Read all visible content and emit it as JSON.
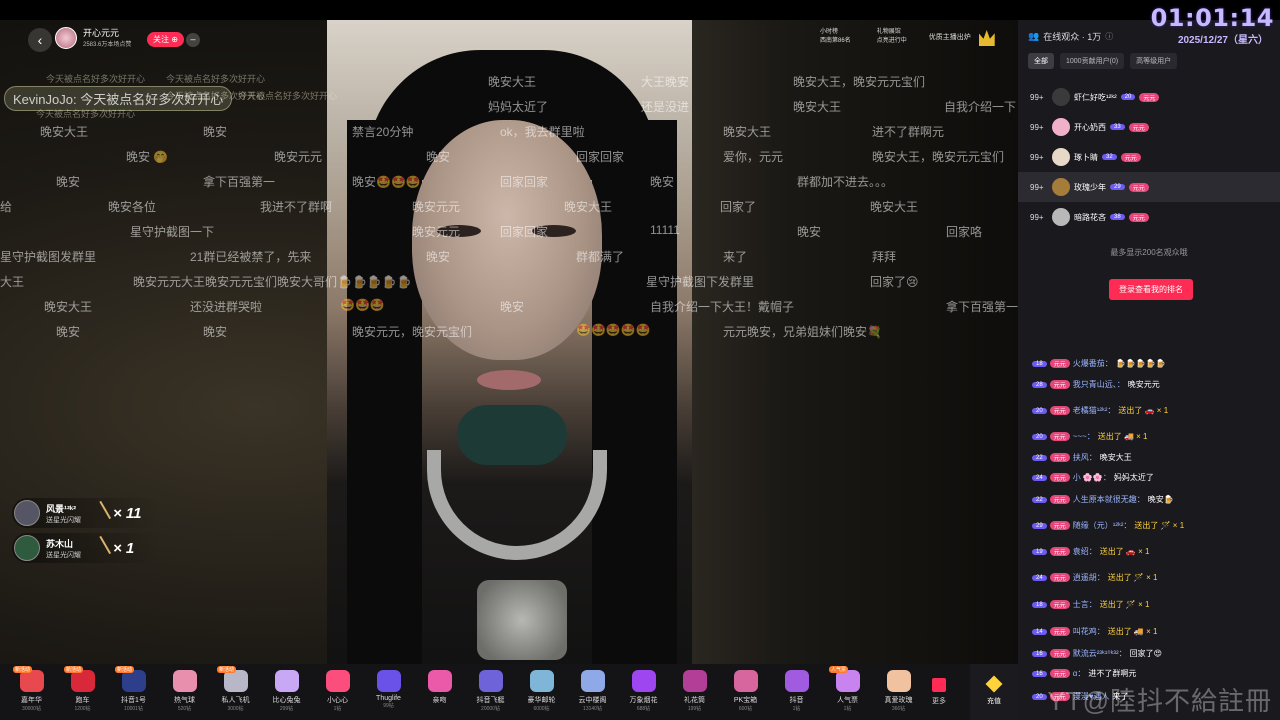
{
  "overlay": {
    "timer": "01:01:14",
    "date": "2025/12/27（星六）",
    "watermark": "YT@陸抖不給註冊"
  },
  "anchor": {
    "name": "开心元元",
    "stats": "2583.6万本场点赞",
    "follow_label": "关注"
  },
  "top_badges": [
    {
      "line1": "小时榜",
      "line2": "西南第86名"
    },
    {
      "line1": "礼物展馆",
      "line2": "点亮进行中"
    },
    {
      "line1": "优质主播出炉",
      "line2": ""
    }
  ],
  "danmaku": {
    "highlight": "KevinJoJo: 今天被点名好多次好开心",
    "small": [
      "今天被点名好多次好开心",
      "今天被点名好多次好开心",
      "今天被点名好多次好开心",
      "今天被点名好多次好开心",
      "今天被点名好多次好开心"
    ],
    "lines": [
      "晚安大王",
      "大王晚安",
      "晚安大王，晚安元元宝们",
      "妈妈太近了",
      "还是没进",
      "晚安大王",
      "自我介绍一下",
      "晚安大王",
      "晚安",
      "禁言20分钟",
      "ok，我去群里啦",
      "晚安大王",
      "进不了群啊元",
      "晚安 🤭",
      "晚安元元",
      "晚安",
      "回家回家",
      "爱你，元元",
      "晚安大王，晚安元元宝们",
      "晚安",
      "拿下百强第一",
      "晚安🤩🤩🤩",
      "回家回家",
      "晚安",
      "群都加不进去。。。",
      "晚安各位",
      "我进不了群啊",
      "晚安元元",
      "晚安大王",
      "回家了",
      "晚安大王",
      "星守护截图一下",
      "晚安元元",
      "回家回家",
      "11111",
      "晚安",
      "回家咯",
      "21群已经被禁了，先来",
      "晚安",
      "群都满了",
      "来了",
      "拜拜",
      "晚安元元大王晚安元元宝们晚安大哥们🍺🍺🍺🍺🍺",
      "星守护截图下发群里",
      "回家了😢",
      "晚安大王",
      "还没进群哭啦",
      "🤩🤩🤩",
      "晚安",
      "自我介绍一下大王！戴帽子",
      "拿下百强第一",
      "晚安",
      "晚安",
      "晚安元元，晚安元宝们",
      "🤩🤩🤩🤩🤩",
      "元元晚安，兄弟姐妹们晚安💐",
      "星守护截图发群里",
      "大王",
      "给"
    ]
  },
  "gift_notes": [
    {
      "name": "风景¹²ᵏ²",
      "action": "送星光闪耀",
      "count": "× 11"
    },
    {
      "name": "苏木山",
      "action": "送星光闪耀",
      "count": "× 1"
    }
  ],
  "gifts": [
    {
      "name": "嘉年华",
      "price": "30000钻",
      "tag": "新活动",
      "color": "#e8494f"
    },
    {
      "name": "跑车",
      "price": "1200钻",
      "tag": "新活动",
      "color": "#d8283a"
    },
    {
      "name": "抖音1号",
      "price": "10001钻",
      "tag": "新活动",
      "color": "#2d3f8a"
    },
    {
      "name": "热气球",
      "price": "520钻",
      "tag": "",
      "color": "#e98fae"
    },
    {
      "name": "私人飞机",
      "price": "3000钻",
      "tag": "新活动",
      "color": "#b7b7c8"
    },
    {
      "name": "比心兔兔",
      "price": "299钻",
      "tag": "",
      "color": "#c8a8f5"
    },
    {
      "name": "小心心",
      "price": "1钻",
      "tag": "",
      "color": "#fb4e7c"
    },
    {
      "name": "Thuglife",
      "price": "99钻",
      "tag": "",
      "color": "#6a52e8"
    },
    {
      "name": "亲吻",
      "price": "",
      "tag": "",
      "color": "#ea5aa8"
    },
    {
      "name": "抖音飞艇",
      "price": "20000钻",
      "tag": "",
      "color": "#6e63d9"
    },
    {
      "name": "豪华邮轮",
      "price": "6000钻",
      "tag": "",
      "color": "#7fb6d8"
    },
    {
      "name": "云中楼阁",
      "price": "13140钻",
      "tag": "",
      "color": "#8fa9e8"
    },
    {
      "name": "万象烟花",
      "price": "688钻",
      "tag": "",
      "color": "#9e46f0"
    },
    {
      "name": "礼花筒",
      "price": "199钻",
      "tag": "",
      "color": "#b33e98"
    },
    {
      "name": "PK宝箱",
      "price": "600钻",
      "tag": "",
      "color": "#d8669e"
    },
    {
      "name": "抖音",
      "price": "1钻",
      "tag": "",
      "color": "#a05be0"
    },
    {
      "name": "人气票",
      "price": "1钻",
      "tag": "人气票",
      "color": "#c883ef"
    },
    {
      "name": "真爱玫瑰",
      "price": "366钻",
      "tag": "",
      "color": "#f1c2a0"
    }
  ],
  "giftbar": {
    "more_label": "更多",
    "recharge_label": "充值"
  },
  "panel": {
    "audience_title": "在线观众 · 1万",
    "tabs": [
      "全部",
      "1000贡献用户(0)",
      "高等级用户"
    ],
    "viewers": [
      {
        "rank": "99+",
        "name": "虾仁好吃¹²ᵏ²",
        "level": "20",
        "fan": "元元"
      },
      {
        "rank": "99+",
        "name": "开心奶西",
        "level": "33",
        "fan": "元元"
      },
      {
        "rank": "99+",
        "name": "琢卜睛",
        "level": "32",
        "fan": "元元"
      },
      {
        "rank": "99+",
        "name": "玫瑰少年",
        "level": "29",
        "fan": "元元"
      },
      {
        "rank": "99+",
        "name": "暗路花吝",
        "level": "38",
        "fan": "元元"
      }
    ],
    "max_note": "最多显示200名观众哦",
    "rank_button": "登录查看我的排名"
  },
  "chat": [
    {
      "lv": "18",
      "user": "火爆番茄：",
      "text": "🍺🍺🍺🍺🍺",
      "gift": false
    },
    {
      "lv": "28",
      "user": "我只青山远、：",
      "text": "晚安元元",
      "gift": false
    },
    {
      "lv": "20",
      "user": "老橘猫¹²ᵏ²：",
      "text": "送出了 🚗 × 1",
      "gift": true
    },
    {
      "lv": "20",
      "user": "~~~：",
      "text": "送出了 🚚 × 1",
      "gift": true
    },
    {
      "lv": "22",
      "user": "扶风：",
      "text": "晚安大王",
      "gift": false
    },
    {
      "lv": "24",
      "user": "小 🌸🌸：",
      "text": "妈妈太近了",
      "gift": false
    },
    {
      "lv": "22",
      "user": "人生原本就很无趣：",
      "text": "晚安🍺",
      "gift": false
    },
    {
      "lv": "29",
      "user": "随缘（元）¹²ᵏ²：",
      "text": "送出了 🪄 × 1",
      "gift": true
    },
    {
      "lv": "19",
      "user": "袁绍：",
      "text": "送出了 🚗 × 1",
      "gift": true
    },
    {
      "lv": "24",
      "user": "逍遥胡：",
      "text": "送出了 🪄 × 1",
      "gift": true
    },
    {
      "lv": "18",
      "user": "士言：",
      "text": "送出了 🪄 × 1",
      "gift": true
    },
    {
      "lv": "14",
      "user": "叫花鸡：",
      "text": "送出了 🚚 × 1",
      "gift": true
    },
    {
      "lv": "16",
      "user": "默流云²³ᵏ¹⁰ᵏ³²：",
      "text": "回家了😍",
      "gift": false
    },
    {
      "lv": "16",
      "user": "α：",
      "text": "进不了群啊元",
      "gift": false
    },
    {
      "lv": "20",
      "user": "漫漫♥遇人",
      "text": "来了",
      "gift": false
    }
  ]
}
